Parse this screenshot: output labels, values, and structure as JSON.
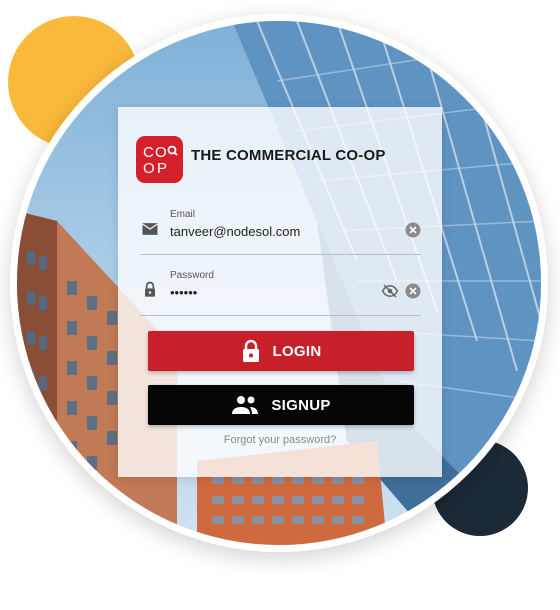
{
  "brand": {
    "logo_text": "CO OP",
    "name": "THE COMMERCIAL CO-OP"
  },
  "form": {
    "email": {
      "label": "Email",
      "value": "tanveer@nodesol.com"
    },
    "password": {
      "label": "Password",
      "value": "••••••"
    }
  },
  "buttons": {
    "login": "LOGIN",
    "signup": "SIGNUP"
  },
  "links": {
    "forgot": "Forgot your password?"
  },
  "colors": {
    "accent": "#c8202a",
    "signup": "#050505",
    "yellow": "#f9b93a",
    "navy": "#1b2a36"
  },
  "icons": [
    "email-icon",
    "lock-icon",
    "clear-icon",
    "visibility-off-icon",
    "people-icon"
  ]
}
